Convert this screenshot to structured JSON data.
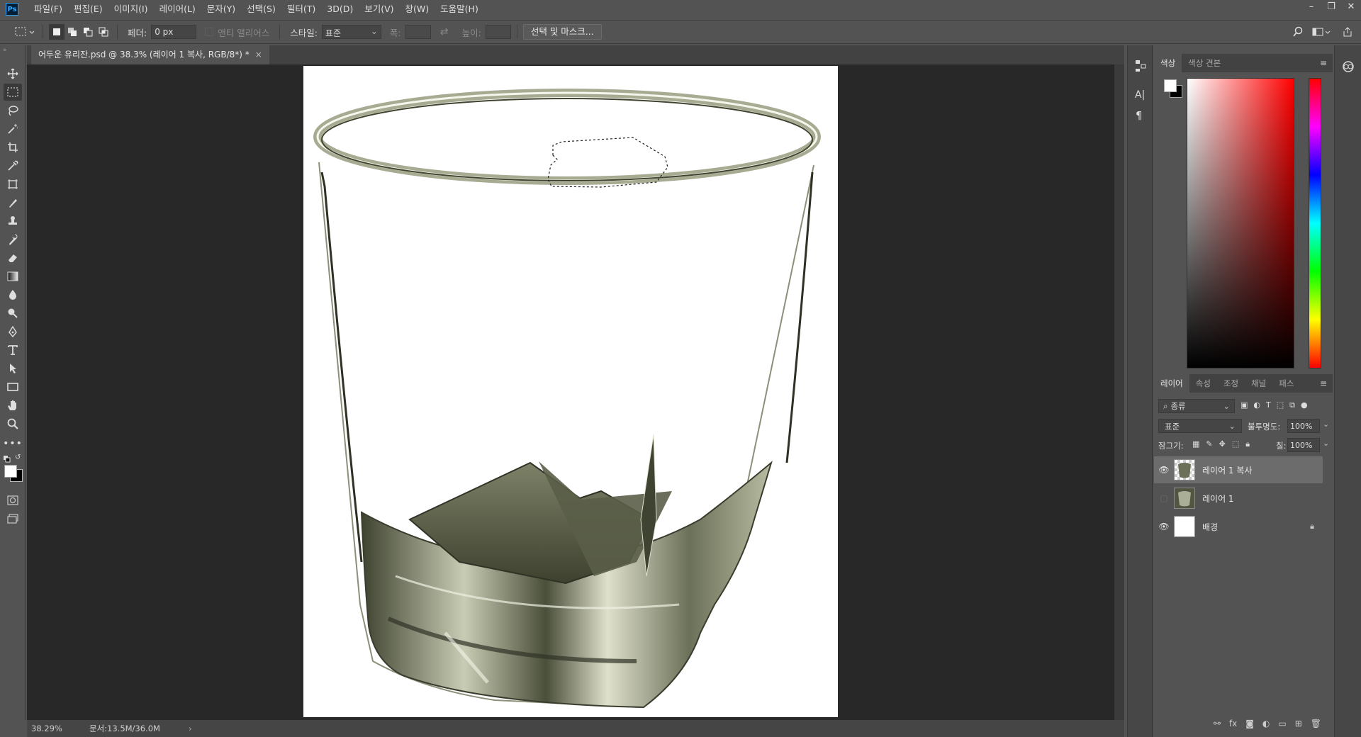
{
  "app": {
    "logo": "Ps"
  },
  "menu": [
    "파일(F)",
    "편집(E)",
    "이미지(I)",
    "레이어(L)",
    "문자(Y)",
    "선택(S)",
    "필터(T)",
    "3D(D)",
    "보기(V)",
    "창(W)",
    "도움말(H)"
  ],
  "window_controls": {
    "minimize": "–",
    "restore": "❐",
    "close": "✕"
  },
  "options": {
    "feather_label": "페더:",
    "feather_value": "0 px",
    "antialias_label": "앤티 앨리어스",
    "style_label": "스타일:",
    "style_value": "표준",
    "width_label": "폭:",
    "height_label": "높이:",
    "select_mask_button": "선택 및 마스크..."
  },
  "document": {
    "tab_title": "어두운 유리잔.psd @ 38.3% (레이어 1 복사, RGB/8*) *",
    "tab_close": "×"
  },
  "status": {
    "zoom": "38.29%",
    "doc_size": "문서:13.5M/36.0M",
    "arrow": "›"
  },
  "color_panel": {
    "tabs": [
      "색상",
      "색상 견본"
    ],
    "active_tab": 0
  },
  "layers_panel": {
    "tabs": [
      "레이어",
      "속성",
      "조정",
      "채널",
      "패스"
    ],
    "filter_label": "종류",
    "blend_mode": "표준",
    "opacity_label": "불투명도:",
    "opacity_value": "100%",
    "lock_label": "잠그기:",
    "fill_label": "칠:",
    "fill_value": "100%",
    "layers": [
      {
        "name": "레이어 1 복사",
        "visible": true,
        "selected": true
      },
      {
        "name": "레이어 1",
        "visible": false,
        "selected": false
      },
      {
        "name": "배경",
        "visible": true,
        "selected": false,
        "locked": true
      }
    ]
  },
  "colors": {
    "foreground": "#ffffff",
    "background": "#000000",
    "ui_bg": "#535353",
    "pasteboard": "#282828"
  }
}
